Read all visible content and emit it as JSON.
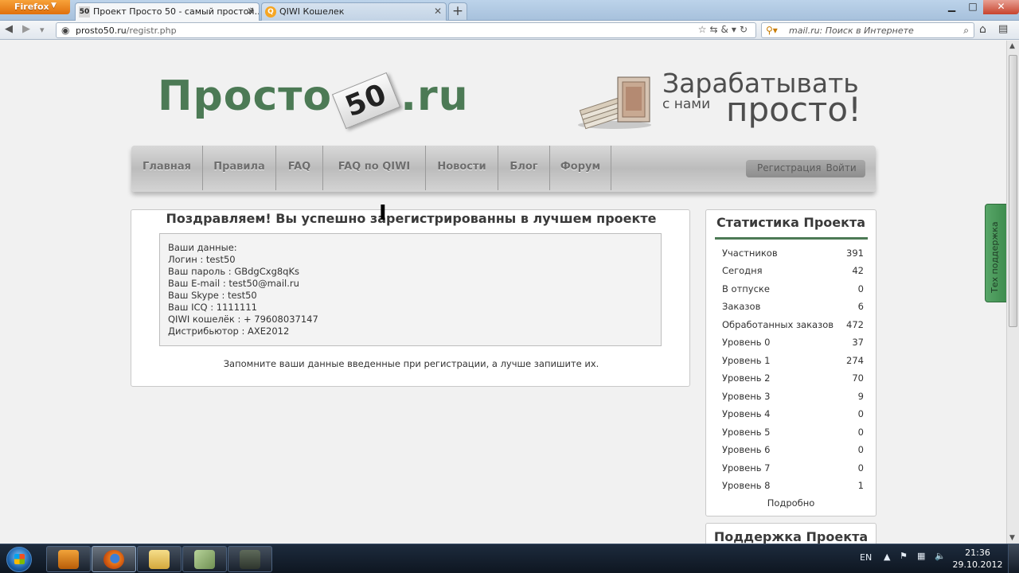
{
  "browser": {
    "app_button": "Firefox",
    "tabs": [
      {
        "favicon": "50",
        "title": "Проект Просто 50 - самый простой..."
      },
      {
        "favicon": "Q",
        "title": "QIWI Кошелек"
      }
    ],
    "url_host": "prosto50.ru",
    "url_path": "/registr.php",
    "search_placeholder": "mail.ru: Поиск в Интернете"
  },
  "header": {
    "logo_left": "Просто",
    "logo_badge": "50",
    "logo_right": ".ru",
    "slogan_line1": "Зарабатывать",
    "slogan_line2_small": "с нами",
    "slogan_line2_big": "просто!"
  },
  "menu": {
    "items": [
      "Главная",
      "Правила",
      "FAQ",
      "FAQ по QIWI",
      "Новости",
      "Блог",
      "Форум"
    ],
    "register": "Регистрация",
    "login": "Войти"
  },
  "main": {
    "title": "Поздравляем! Вы успешно зарегистрированны в лучшем проекте",
    "data_heading": "Ваши данные:",
    "lines": [
      "Логин : test50",
      "Ваш пароль : GBdgCxg8qKs",
      "Ваш E-mail : test50@mail.ru",
      "Ваш Skype : test50",
      "Ваш ICQ : 1111111",
      "QIWI кошелёк : + 79608037147",
      "Дистрибьютор : AXE2012"
    ],
    "note": "Запомните ваши данные введенные при регистрации, а лучше запишите их."
  },
  "stats": {
    "title": "Статистика Проекта",
    "rows": [
      {
        "label": "Участников",
        "value": "391"
      },
      {
        "label": "Сегодня",
        "value": "42"
      },
      {
        "label": "В отпуске",
        "value": "0"
      },
      {
        "label": "Заказов",
        "value": "6"
      },
      {
        "label": "Обработанных заказов",
        "value": "472"
      },
      {
        "label": "Уровень 0",
        "value": "37"
      },
      {
        "label": "Уровень 1",
        "value": "274"
      },
      {
        "label": "Уровень 2",
        "value": "70"
      },
      {
        "label": "Уровень 3",
        "value": "9"
      },
      {
        "label": "Уровень 4",
        "value": "0"
      },
      {
        "label": "Уровень 5",
        "value": "0"
      },
      {
        "label": "Уровень 6",
        "value": "0"
      },
      {
        "label": "Уровень 7",
        "value": "0"
      },
      {
        "label": "Уровень 8",
        "value": "1"
      }
    ],
    "more": "Подробно"
  },
  "support": {
    "title": "Поддержка Проекта"
  },
  "tech_support_tab": "Тех поддержка",
  "taskbar": {
    "language": "EN",
    "time": "21:36",
    "date": "29.10.2012"
  },
  "colors": {
    "brand_green": "#4c7a55",
    "firefox_orange": "#e0700c"
  }
}
